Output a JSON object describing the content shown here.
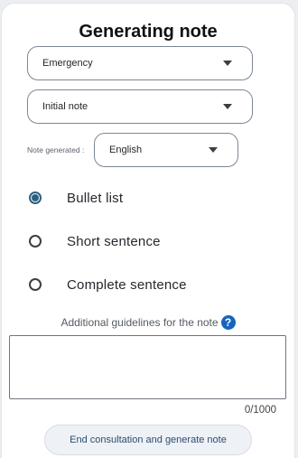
{
  "title": "Generating note",
  "dropdowns": {
    "specialty": {
      "value": "Emergency"
    },
    "note_type": {
      "value": "Initial note"
    },
    "language": {
      "label": "Note generated :",
      "value": "English"
    }
  },
  "format_options": [
    {
      "label": "Bullet list",
      "selected": true
    },
    {
      "label": "Short sentence",
      "selected": false
    },
    {
      "label": "Complete sentence",
      "selected": false
    }
  ],
  "guidelines": {
    "label": "Additional guidelines for the note",
    "help_icon": "question-mark-circle",
    "value": "",
    "counter": "0/1000"
  },
  "submit_label": "End consultation and generate note",
  "colors": {
    "accent": "#2d5f7f",
    "help_icon": "#1565c0",
    "button_bg": "#eef1f6"
  }
}
